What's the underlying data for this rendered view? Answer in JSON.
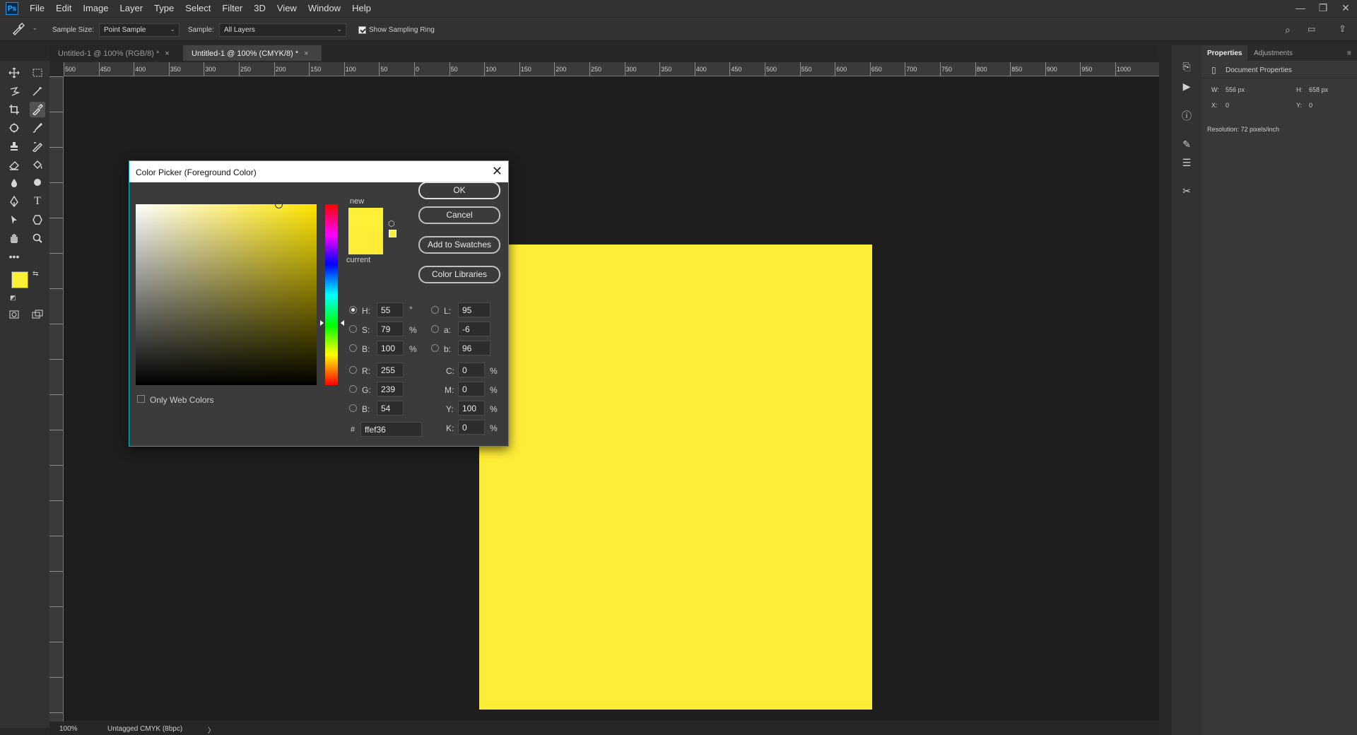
{
  "app": {
    "logo": "Ps"
  },
  "menu": [
    "File",
    "Edit",
    "Image",
    "Layer",
    "Type",
    "Select",
    "Filter",
    "3D",
    "View",
    "Window",
    "Help"
  ],
  "window_controls": {
    "minimize": "—",
    "restore": "❐",
    "close": "✕"
  },
  "options": {
    "sample_size_label": "Sample Size:",
    "sample_size_value": "Point Sample",
    "sample_label": "Sample:",
    "sample_value": "All Layers",
    "show_ring_label": "Show Sampling Ring",
    "show_ring_checked": true
  },
  "tabs": [
    {
      "label": "Untitled-1 @ 100% (RGB/8) *",
      "active": false
    },
    {
      "label": "Untitled-1 @ 100% (CMYK/8) *",
      "active": true
    }
  ],
  "hruler_labels": [
    "500",
    "450",
    "400",
    "350",
    "300",
    "250",
    "200",
    "150",
    "100",
    "50",
    "0",
    "50",
    "100",
    "150",
    "200",
    "250",
    "300",
    "350",
    "400",
    "450",
    "500",
    "550",
    "600",
    "650",
    "700",
    "750",
    "800",
    "850",
    "900",
    "950",
    "1000"
  ],
  "document": {
    "fill": "#ffec36"
  },
  "status": {
    "zoom": "100%",
    "profile": "Untagged CMYK (8bpc)",
    "arrow": "〉"
  },
  "colors": {
    "foreground": "#ffef36",
    "background": "#ffffff",
    "accent": "#00b5bd"
  },
  "properties": {
    "tab_properties": "Properties",
    "tab_adjustments": "Adjustments",
    "section": "Document Properties",
    "w_label": "W:",
    "w_value": "556 px",
    "h_label": "H:",
    "h_value": "658 px",
    "x_label": "X:",
    "x_value": "0",
    "y_label": "Y:",
    "y_value": "0",
    "resolution": "Resolution: 72 pixels/inch"
  },
  "dialog": {
    "title": "Color Picker (Foreground Color)",
    "new_label": "new",
    "current_label": "current",
    "new_color": "#ffef36",
    "current_color": "#ffec36",
    "buttons": {
      "ok": "OK",
      "cancel": "Cancel",
      "add_swatches": "Add to Swatches",
      "libraries": "Color Libraries"
    },
    "only_web_colors": "Only Web Colors",
    "hsb": {
      "h_label": "H:",
      "h": "55",
      "h_unit": "°",
      "s_label": "S:",
      "s": "79",
      "s_unit": "%",
      "b_label": "B:",
      "b": "100",
      "b_unit": "%"
    },
    "rgb": {
      "r_label": "R:",
      "r": "255",
      "g_label": "G:",
      "g": "239",
      "b_label": "B:",
      "b": "54"
    },
    "lab": {
      "l_label": "L:",
      "l": "95",
      "a_label": "a:",
      "a": "-6",
      "b_label": "b:",
      "b": "96"
    },
    "cmyk": {
      "c_label": "C:",
      "c": "0",
      "m_label": "M:",
      "m": "0",
      "y_label": "Y:",
      "y": "100",
      "k_label": "K:",
      "k": "0",
      "unit": "%"
    },
    "hex_label": "#",
    "hex": "ffef36"
  }
}
